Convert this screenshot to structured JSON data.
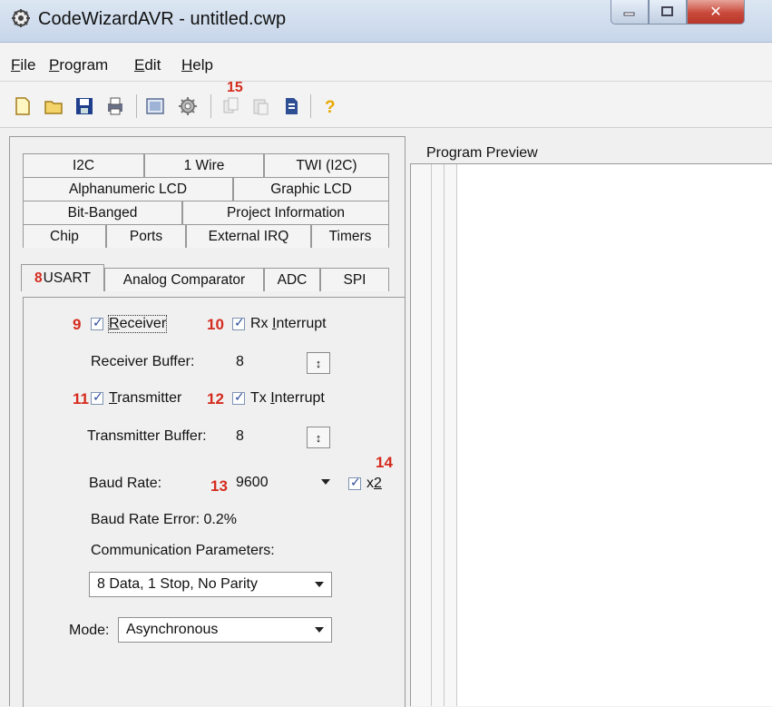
{
  "window": {
    "title": "CodeWizardAVR - untitled.cwp"
  },
  "menu": [
    {
      "key": "F",
      "rest": "ile"
    },
    {
      "key": "P",
      "rest": "rogram"
    },
    {
      "key": "E",
      "rest": "dit"
    },
    {
      "key": "H",
      "rest": "elp"
    }
  ],
  "toolbar": {
    "icons": [
      "new-file-icon",
      "open-folder-icon",
      "save-icon",
      "print-icon",
      "preview-icon",
      "generate-gear-icon",
      "copy-icon",
      "paste-icon",
      "document-icon",
      "help-icon"
    ],
    "callout": "15"
  },
  "tabs": {
    "row1": [
      "I2C",
      "1 Wire",
      "TWI (I2C)"
    ],
    "row2": [
      "Alphanumeric LCD",
      "Graphic LCD"
    ],
    "row3": [
      "Bit-Banged",
      "Project Information"
    ],
    "row4": [
      "Chip",
      "Ports",
      "External IRQ",
      "Timers"
    ],
    "row5": [
      "USART",
      "Analog Comparator",
      "ADC",
      "SPI"
    ],
    "active_callout": "8"
  },
  "usart": {
    "receiver": {
      "callout": "9",
      "label_key": "R",
      "label_rest": "eceiver",
      "checked": true
    },
    "rx_interrupt": {
      "callout": "10",
      "label_pre": "Rx ",
      "label_key": "I",
      "label_rest": "nterrupt",
      "checked": true
    },
    "receiver_buffer": {
      "label": "Receiver Buffer:",
      "value": "8"
    },
    "transmitter": {
      "callout": "11",
      "label_key": "T",
      "label_rest": "ransmitter",
      "checked": true
    },
    "tx_interrupt": {
      "callout": "12",
      "label_pre": "Tx ",
      "label_key": "I",
      "label_rest": "nterrupt",
      "checked": true
    },
    "transmitter_buffer": {
      "label": "Transmitter Buffer:",
      "value": "8"
    },
    "baud_rate": {
      "label": "Baud Rate:",
      "callout": "13",
      "value": "9600"
    },
    "x2": {
      "callout": "14",
      "label_pre": "x",
      "label_key": "2",
      "checked": true
    },
    "baud_rate_error": "Baud Rate Error: 0.2%",
    "comm_params_label": "Communication Parameters:",
    "comm_params_value": "8 Data, 1 Stop, No Parity",
    "mode_label": "Mode:",
    "mode_value": "Asynchronous"
  },
  "preview": {
    "title": "Program Preview"
  },
  "colors": {
    "callout": "#d52b1e",
    "titlebar": "#c7d6ea",
    "close": "#c8493a"
  }
}
